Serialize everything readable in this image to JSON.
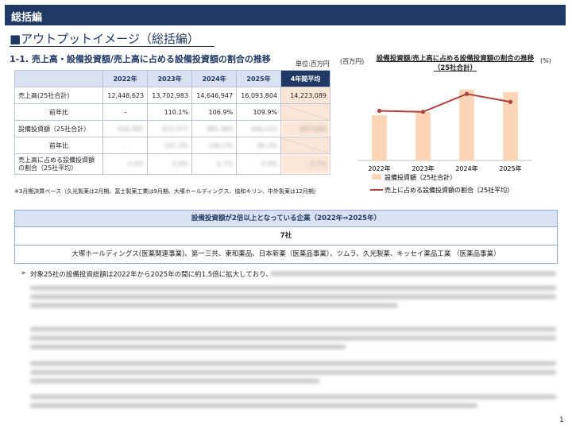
{
  "header": {
    "title": "総括編"
  },
  "subtitle": "■アウトプットイメージ（総括編）",
  "section_title": "1-1. 売上高・設備投資額/売上高に占める設備投資額の割合の推移",
  "unit_label": "単位:百万円",
  "table": {
    "headers": [
      "",
      "2022年",
      "2023年",
      "2024年",
      "2025年",
      "4年間平均"
    ],
    "rows": [
      {
        "label": "売上高(25社合計)",
        "cells": [
          "12,448,623",
          "13,702,983",
          "14,646,947",
          "16,093,804",
          "14,223,089"
        ]
      },
      {
        "label": "前年比",
        "cells": [
          "–",
          "110.1%",
          "106.9%",
          "109.9%",
          ""
        ]
      },
      {
        "label": "設備投資額（25社合計）",
        "cells": [
          "626,087",
          "672,077",
          "981,965",
          "946,015",
          "807,040"
        ]
      },
      {
        "label": "前年比",
        "cells": [
          "–",
          "107.3%",
          "146.1%",
          "96.3%",
          ""
        ]
      },
      {
        "label": "売上高に占める設備投資額の割合（25社平均）",
        "cells": [
          "5.0%",
          "4.9%",
          "6.7%",
          "5.9%",
          "5.7%"
        ]
      }
    ]
  },
  "note": "※3月期決算ベース（久光製薬は2月期、富士製薬工業は9月期、大塚ホールディングス、協和キリン、中外製薬は12月期）",
  "chart_unit_left": "(百万円)",
  "chart_unit_right": "(%)",
  "chart_data": {
    "type": "bar",
    "title": "設備投資額/売上高に占める設備投資額の割合の推移（25社合計）",
    "categories": [
      "2022年",
      "2023年",
      "2024年",
      "2025年"
    ],
    "series": [
      {
        "name": "設備投資額（25社合計）",
        "type": "bar",
        "values": [
          626087,
          672077,
          981965,
          946015
        ],
        "color": "#fbd5b5"
      },
      {
        "name": "売上に占める設備投資額の割合（25社平均）",
        "type": "line",
        "values": [
          5.0,
          4.9,
          6.7,
          5.9
        ],
        "color": "#b04040"
      }
    ],
    "ylim_bar": [
      0,
      1100000
    ],
    "ylim_line": [
      0,
      8
    ]
  },
  "company_box": {
    "head": "設備投資額が2倍以上となっている企業（2022年⇒2025年）",
    "count": "7社",
    "companies": "大塚ホールディングス(医薬関連事業)、第一三共、東和薬品、日本新薬（医薬品事業）、ツムラ、久光製薬、キッセイ薬品工業 （医薬品事業）"
  },
  "bullets": [
    {
      "marker": "➢",
      "text": "対象25社の設備投資総額は2022年から2025年の間に約1.5倍に拡大しており、"
    }
  ],
  "page_number": "1"
}
